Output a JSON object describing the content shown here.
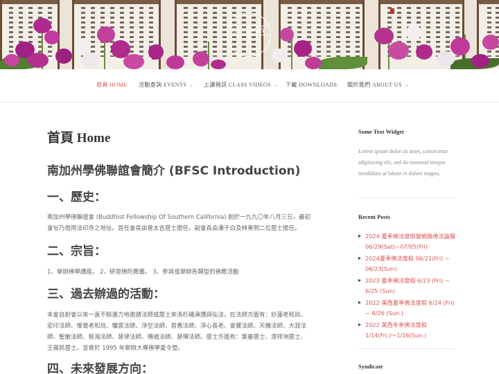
{
  "banner": {
    "logo_text": "GATEWAY",
    "logo_chevron": "⌄"
  },
  "nav": {
    "items": [
      {
        "label": "首頁 HOME",
        "has_caret": false,
        "active": true
      },
      {
        "label": "活動查詢 EVENTS",
        "has_caret": true,
        "active": false
      },
      {
        "label": "上課視訊 CLASS VIDEOS",
        "has_caret": true,
        "active": false
      },
      {
        "label": "下載 DOWNLOADS",
        "has_caret": false,
        "active": false
      },
      {
        "label": "關於我們 ABOUT US",
        "has_caret": true,
        "active": false
      }
    ],
    "caret": "⌄"
  },
  "main": {
    "page_title": "首頁 Home",
    "intro_heading": "南加州學佛聯誼會簡介 (BFSC Introduction)",
    "sections": [
      {
        "heading": "一、歷史：",
        "body": "南加州學佛聯誼會 (Buddhist Fellowship Of Southern California) 創於一九九〇年八月三日，最初會址乃借用法印寺之地址。首任會長由曾太吉居士擔任，副會長由潘子白及林東明二位居士擔任。"
      },
      {
        "heading": "二、宗旨：",
        "body": "1、舉辦佛學講座。 2、研習佛陀教義。 3、參與或舉辦各類型的佛教活動"
      },
      {
        "heading": "三、過去辦過的活動：",
        "body": "本會自創會以來一直不餘遺力地邀請法師或居士來洛杉磯演講與弘法，在法師方面有：妙蓮老和尚、宏印法師、惟覺老和尚、懺雲法師、淨空法師、首愚法師、淨心長老、會寶法師、天機法師、大寂法師、聖嚴法師、智海法師、慧律法師、傳道法師、慧傳法師。居士方面有：葉曼居士、游祥洲居士、王薇民居士。並曾於 1995 年舉辦大專佛學夏令營。"
      },
      {
        "heading": "四、未來發展方向：",
        "body": ""
      }
    ]
  },
  "sidebar": {
    "text_widget": {
      "title": "Some Text Widget",
      "body": "Lorem ipsum dolor sit amet, consectetur adipisicing elit, sed do eiusmod tempor incididunt ut labore et dolore magna."
    },
    "recent_posts": {
      "title": "Recent Posts",
      "items": [
        "2024 夏季佛法度假營網路佛法論壇 06/29(Sat)~07/05(Fri)",
        "2024夏季佛法度假 06/21(Fri) ~ 06/23(Sun)",
        "2023 夏季佛法度假 6/23 (Fri) ~ 6/25 (Sun)",
        "2022 美西夏季佛法度假 6/24 (Fri) ~ 6/26 (Sun.)",
        "2022 美西冬季佛法度假 1/14(Fri.)〜1/16(Sun.)"
      ]
    },
    "syndicate": {
      "title": "Syndicate"
    }
  },
  "colors": {
    "accent": "#d9534f",
    "text": "#555555",
    "heading": "#444444"
  }
}
